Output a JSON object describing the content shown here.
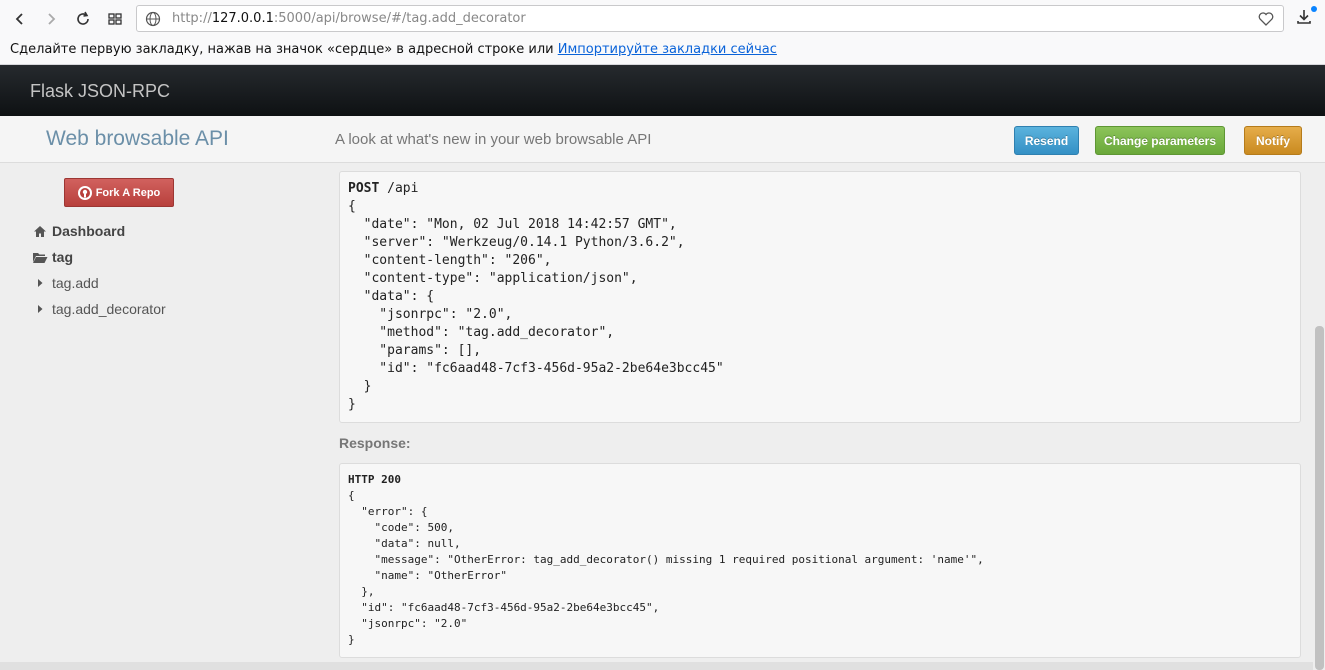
{
  "browser": {
    "url_prefix": "http://",
    "url_host": "127.0.0.1",
    "url_rest": ":5000/api/browse/#/tag.add_decorator",
    "bookmark_message": "Сделайте первую закладку, нажав на значок «сердце» в адресной строке или ",
    "bookmark_link": "Импортируйте закладки сейчас"
  },
  "navbar": {
    "brand": "Flask JSON-RPC"
  },
  "header": {
    "title": "Web browsable API",
    "subtitle": "A look at what's new in your web browsable API",
    "resend_label": "Resend",
    "change_label": "Change parameters",
    "notify_label": "Notify"
  },
  "sidebar": {
    "fork_label": "Fork A Repo",
    "items": [
      {
        "label": "Dashboard",
        "icon": "home-icon"
      },
      {
        "label": "tag",
        "icon": "folder-open-icon"
      },
      {
        "label": "tag.add",
        "icon": "caret-right-icon"
      },
      {
        "label": "tag.add_decorator",
        "icon": "caret-right-icon"
      }
    ]
  },
  "request": {
    "method": "POST",
    "path": " /api",
    "body": "{\n  \"date\": \"Mon, 02 Jul 2018 14:42:57 GMT\",\n  \"server\": \"Werkzeug/0.14.1 Python/3.6.2\",\n  \"content-length\": \"206\",\n  \"content-type\": \"application/json\",\n  \"data\": {\n    \"jsonrpc\": \"2.0\",\n    \"method\": \"tag.add_decorator\",\n    \"params\": [],\n    \"id\": \"fc6aad48-7cf3-456d-95a2-2be64e3bcc45\"\n  }\n}"
  },
  "response": {
    "label": "Response:",
    "status": "HTTP 200",
    "body": "{\n  \"error\": {\n    \"code\": 500,\n    \"data\": null,\n    \"message\": \"OtherError: tag_add_decorator() missing 1 required positional argument: 'name'\",\n    \"name\": \"OtherError\"\n  },\n  \"id\": \"fc6aad48-7cf3-456d-95a2-2be64e3bcc45\",\n  \"jsonrpc\": \"2.0\"\n}"
  },
  "colors": {
    "navbar": "#1a1d20",
    "title": "#6b8fa8",
    "resend": "#3f9fd0",
    "change": "#7ab648",
    "notify": "#d99a2f",
    "fork": "#c14f4b"
  }
}
